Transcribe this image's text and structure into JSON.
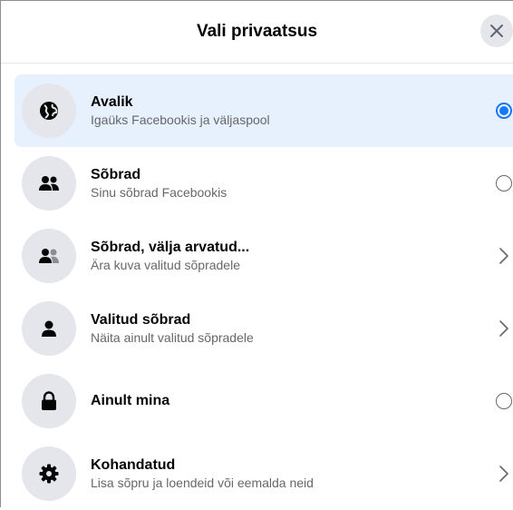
{
  "dialog": {
    "title": "Vali privaatsus",
    "close_icon": "close-icon"
  },
  "colors": {
    "accent": "#1877f2",
    "selected_bg": "#e7f0fd",
    "icon_bg": "#e4e6eb",
    "secondary_text": "#65676b"
  },
  "options": [
    {
      "label": "Avalik",
      "description": "Igaüks Facebookis ja väljaspool",
      "icon": "globe-icon",
      "control": "radio",
      "selected": true
    },
    {
      "label": "Sõbrad",
      "description": "Sinu sõbrad Facebookis",
      "icon": "friends-icon",
      "control": "radio",
      "selected": false
    },
    {
      "label": "Sõbrad, välja arvatud...",
      "description": "Ära kuva valitud sõpradele",
      "icon": "friends-except-icon",
      "control": "chevron",
      "selected": false
    },
    {
      "label": "Valitud sõbrad",
      "description": "Näita ainult valitud sõpradele",
      "icon": "person-icon",
      "control": "chevron",
      "selected": false
    },
    {
      "label": "Ainult mina",
      "description": "",
      "icon": "lock-icon",
      "control": "radio",
      "selected": false
    },
    {
      "label": "Kohandatud",
      "description": "Lisa sõpru ja loendeid või eemalda neid",
      "icon": "gear-icon",
      "control": "chevron",
      "selected": false
    }
  ]
}
